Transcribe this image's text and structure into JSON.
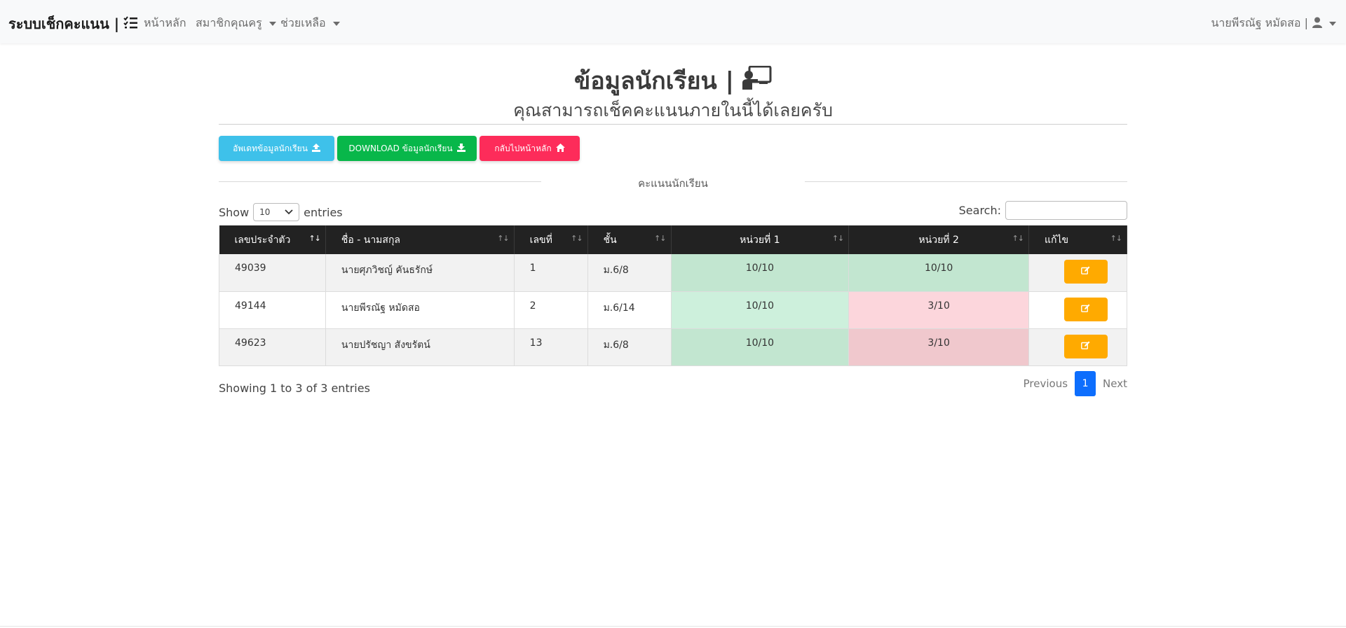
{
  "navbar": {
    "brand": "ระบบเช็กคะแนน |",
    "links": [
      {
        "label": "หน้าหลัก"
      },
      {
        "label": "สมาชิกคุณครู"
      },
      {
        "label": "ช่วยเหลือ"
      }
    ],
    "user": "นายพีรณัฐ หมัดสอ |"
  },
  "header": {
    "title": "ข้อมูลนักเรียน |",
    "subtitle": "คุณสามารถเช็คคะแนนภายในนี้ได้เลยครับ"
  },
  "buttons": {
    "update": "อัพเดทข้อมูลนักเรียน",
    "download": "DOWNLOAD ข้อมูลนักเรียน",
    "home": "กลับไปหน้าหลัก"
  },
  "section_label": "คะแนนนักเรียน",
  "datatable": {
    "show_label": "Show",
    "entries_value": "10",
    "entries_label": "entries",
    "search_label": "Search:",
    "columns": [
      "เลขประจำตัว",
      "ชื่อ - นามสกุล",
      "เลขที่",
      "ชั้น",
      "หน่วยที่ 1",
      "หน่วยที่ 2",
      "แก้ไข"
    ],
    "rows": [
      {
        "id": "49039",
        "name": "นายศุภวิชญ์ คันธรักษ์",
        "no": "1",
        "class": "ม.6/8",
        "unit1": "10/10",
        "unit2": "10/10"
      },
      {
        "id": "49144",
        "name": "นายพีรณัฐ หมัดสอ",
        "no": "2",
        "class": "ม.6/14",
        "unit1": "10/10",
        "unit2": "3/10"
      },
      {
        "id": "49623",
        "name": "นายปรัชญา สังขรัตน์",
        "no": "13",
        "class": "ม.6/8",
        "unit1": "10/10",
        "unit2": "3/10"
      }
    ],
    "info": "Showing 1 to 3 of 3 entries",
    "previous": "Previous",
    "page": "1",
    "next": "Next"
  },
  "colors": {
    "navbar_bg": "#f8f9fa",
    "header_bg": "#222222",
    "btn_info": "#3ec1ea",
    "btn_success": "#08b74a",
    "btn_danger": "#fd2c5a",
    "btn_edit": "#ffaa00",
    "pass_cell": "#c2e6d0",
    "fail_cell": "#fcd6dc",
    "page_active": "#0d6efd"
  },
  "icons": [
    "list-check-icon",
    "user-icon",
    "chalkboard-teacher-icon",
    "upload-icon",
    "download-icon",
    "home-icon",
    "edit-icon",
    "sort-icon"
  ]
}
